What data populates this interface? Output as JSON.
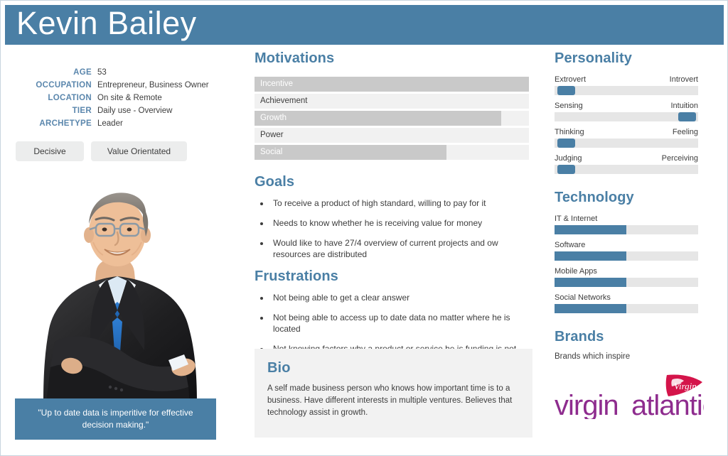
{
  "header": {
    "name": "Kevin Bailey"
  },
  "profile": {
    "facts": [
      {
        "label": "AGE",
        "value": "53"
      },
      {
        "label": "OCCUPATION",
        "value": "Entrepreneur, Business Owner"
      },
      {
        "label": "LOCATION",
        "value": "On site & Remote"
      },
      {
        "label": "TIER",
        "value": "Daily use - Overview"
      },
      {
        "label": "ARCHETYPE",
        "value": "Leader"
      }
    ],
    "tags": [
      "Decisive",
      "Value Orientated"
    ],
    "photo_alt": "portrait-photo-businessman",
    "quote": "\"Up to date data is imperitive for effective decision making.\""
  },
  "motivations": {
    "title": "Motivations",
    "items": [
      {
        "label": "Incentive",
        "percent": 100,
        "style": "dark"
      },
      {
        "label": "Achievement",
        "percent": 100,
        "style": "light"
      },
      {
        "label": "Growth",
        "percent": 90,
        "style": "dark"
      },
      {
        "label": "Power",
        "percent": 78,
        "style": "light"
      },
      {
        "label": "Social",
        "percent": 70,
        "style": "dark"
      }
    ]
  },
  "goals": {
    "title": "Goals",
    "items": [
      "To receive a product of high standard, willing to pay for it",
      "Needs to know whether he is receiving value for money",
      "Would like to have 27/4 overview of current projects and ow resources are distributed"
    ]
  },
  "frustrations": {
    "title": "Frustrations",
    "items": [
      "Not being able to get a clear answer",
      "Not being able to access up to date data no matter where he is located",
      "Not knowing factors why a product or service he is funding is not progressing"
    ]
  },
  "bio": {
    "title": "Bio",
    "text": "A self made business person who knows how important time is to a business. Have different interests in multiple ventures. Believes that technology assist in growth."
  },
  "personality": {
    "title": "Personality",
    "items": [
      {
        "left": "Extrovert",
        "right": "Introvert",
        "position": 2
      },
      {
        "left": "Sensing",
        "right": "Intuition",
        "position": 86
      },
      {
        "left": "Thinking",
        "right": "Feeling",
        "position": 2
      },
      {
        "left": "Judging",
        "right": "Perceiving",
        "position": 2
      }
    ]
  },
  "technology": {
    "title": "Technology",
    "items": [
      {
        "label": "IT & Internet",
        "percent": 50
      },
      {
        "label": "Software",
        "percent": 50
      },
      {
        "label": "Mobile Apps",
        "percent": 50
      },
      {
        "label": "Social Networks",
        "percent": 50
      }
    ]
  },
  "brands": {
    "title": "Brands",
    "subtitle": "Brands which inspire",
    "logo_name": "virgin-atlantic-logo",
    "logo_text": "virgin atlantic",
    "logo_color": "#8e2c8e",
    "logo_flag_color": "#d4144a"
  },
  "colors": {
    "accent_blue": "#4a7fa5",
    "bar_dark": "#c9c9c9",
    "bar_light": "#f1f1f1",
    "track_gray": "#e6e6e6"
  }
}
